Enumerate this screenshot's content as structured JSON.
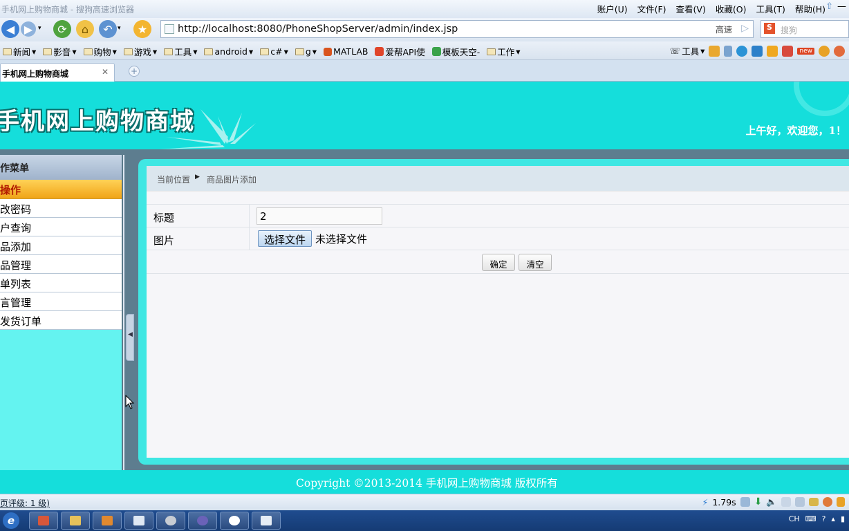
{
  "browser": {
    "window_title": "手机网上购物商城 - 搜狗高速浏览器",
    "menu": [
      "账户(U)",
      "文件(F)",
      "查看(V)",
      "收藏(O)",
      "工具(T)",
      "帮助(H)"
    ],
    "address": "http://localhost:8080/PhoneShopServer/admin/index.jsp",
    "speed_mode": "高速",
    "search_placeholder": "搜狗",
    "bookmarks": [
      "新闻",
      "影音",
      "购物",
      "游戏",
      "工具",
      "android",
      "c#",
      "g",
      "MATLAB",
      "爱帮API使",
      "模板天空-",
      "工作"
    ],
    "bookmark_right_label": "工具",
    "new_badge": "new",
    "tab_title": "手机网上购物商城",
    "status_rating": "页评级: 1 级)",
    "status_time": "1.79s",
    "tray_lang": "CH"
  },
  "site": {
    "logo_text": "手机网上购物商城",
    "welcome": "上午好，欢迎您，1！",
    "footer": "Copyright ©2013-2014 手机网上购物商城 版权所有"
  },
  "sidebar": {
    "title": "作菜单",
    "active": "操作",
    "items": [
      "改密码",
      "户查询",
      "品添加",
      "品管理",
      "单列表",
      "言管理",
      "发货订单"
    ]
  },
  "content": {
    "breadcrumb_label": "当前位置",
    "breadcrumb_page": "商品图片添加",
    "form": {
      "title_label": "标题",
      "title_value": "2",
      "image_label": "图片",
      "file_button": "选择文件",
      "file_status": "未选择文件",
      "confirm": "确定",
      "clear": "清空"
    }
  },
  "colors": {
    "header_bg": "#15dedb",
    "sidebar_bg": "#64f3f0",
    "active_item": "#f0a418"
  }
}
